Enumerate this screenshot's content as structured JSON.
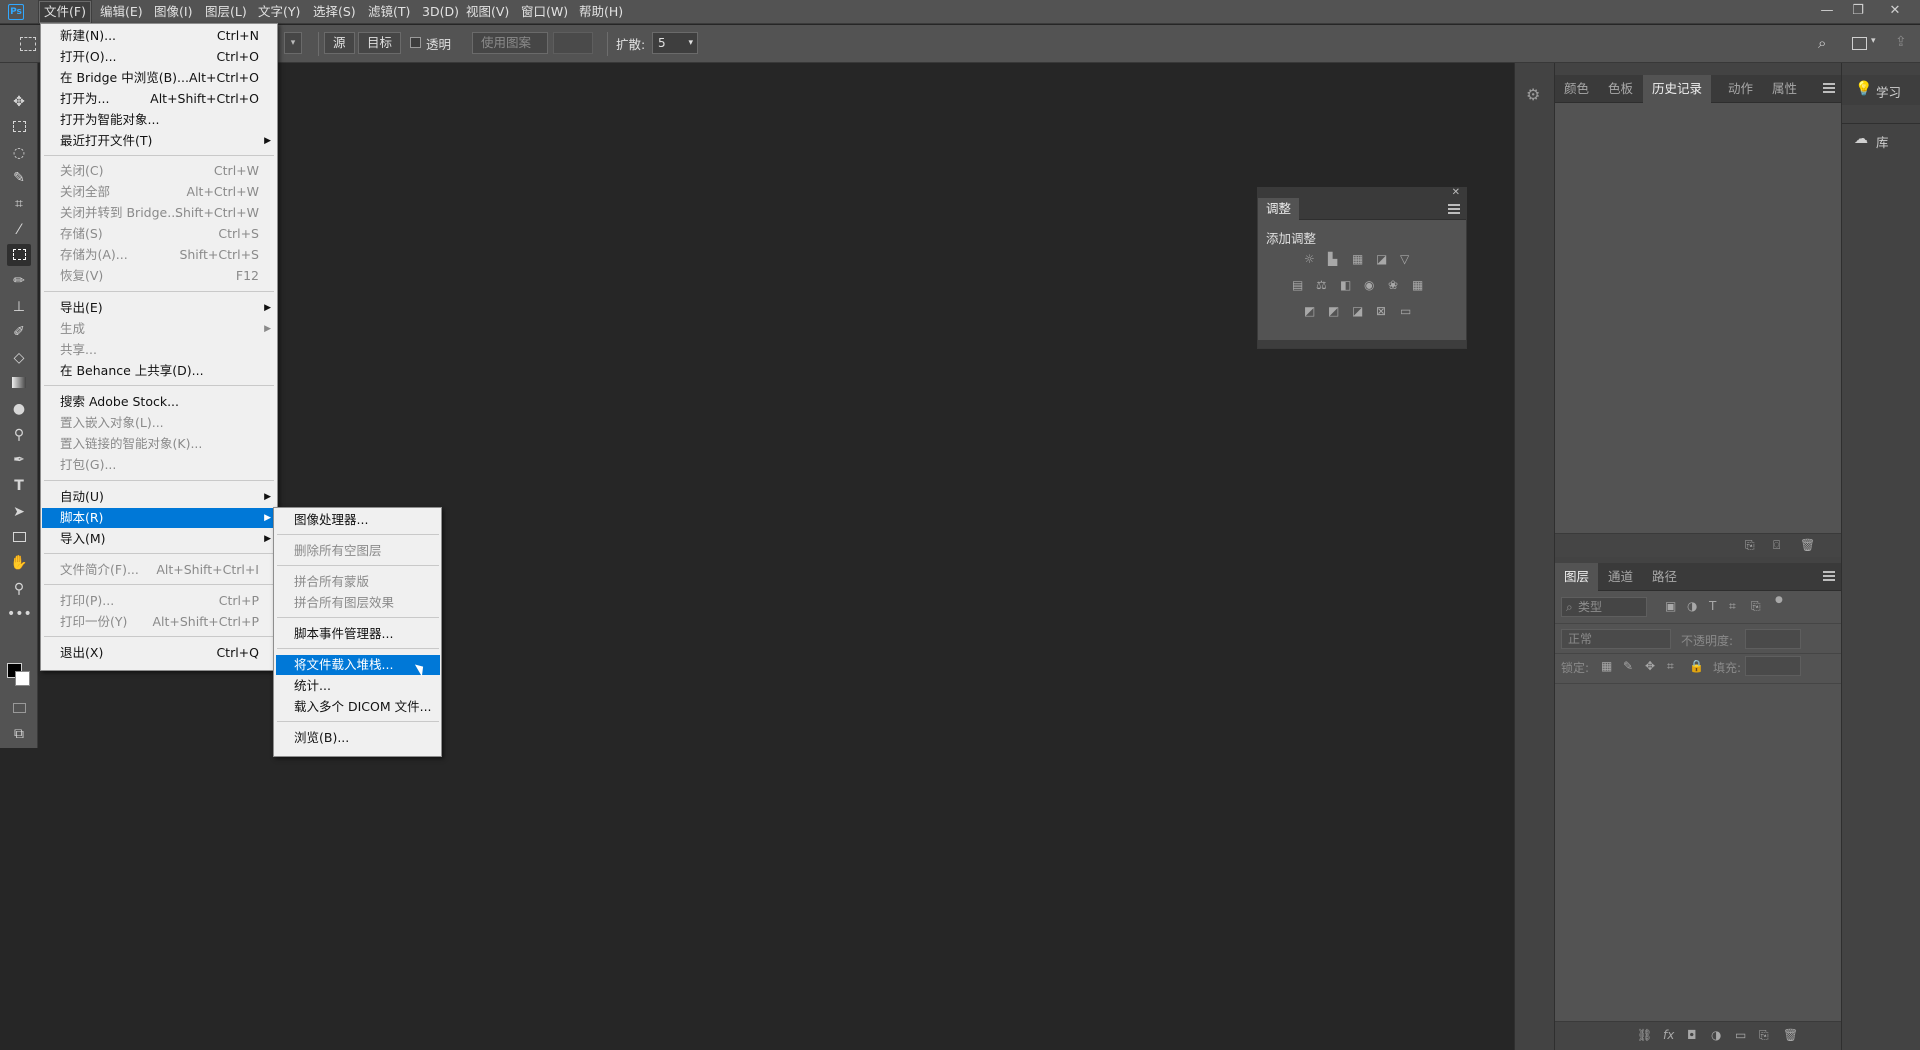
{
  "app": {
    "logo": "Ps"
  },
  "menubar": {
    "items": [
      "文件(F)",
      "编辑(E)",
      "图像(I)",
      "图层(L)",
      "文字(Y)",
      "选择(S)",
      "滤镜(T)",
      "3D(D)",
      "视图(V)",
      "窗口(W)",
      "帮助(H)"
    ]
  },
  "window_controls": {
    "minimize": "—",
    "restore": "❐",
    "close": "✕"
  },
  "options_bar": {
    "source": "源",
    "target": "目标",
    "transparent": "透明",
    "use_pattern": "使用图案",
    "diffusion_label": "扩散:",
    "diffusion_value": "5"
  },
  "file_menu": {
    "items": [
      {
        "label": "新建(N)...",
        "shortcut": "Ctrl+N",
        "disabled": false
      },
      {
        "label": "打开(O)...",
        "shortcut": "Ctrl+O",
        "disabled": false
      },
      {
        "label": "在 Bridge 中浏览(B)...",
        "shortcut": "Alt+Ctrl+O",
        "disabled": false
      },
      {
        "label": "打开为...",
        "shortcut": "Alt+Shift+Ctrl+O",
        "disabled": false
      },
      {
        "label": "打开为智能对象...",
        "shortcut": "",
        "disabled": false
      },
      {
        "label": "最近打开文件(T)",
        "shortcut": "",
        "disabled": false,
        "submenu": true
      },
      {
        "label": "关闭(C)",
        "shortcut": "Ctrl+W",
        "disabled": true
      },
      {
        "label": "关闭全部",
        "shortcut": "Alt+Ctrl+W",
        "disabled": true
      },
      {
        "label": "关闭并转到 Bridge...",
        "shortcut": "Shift+Ctrl+W",
        "disabled": true
      },
      {
        "label": "存储(S)",
        "shortcut": "Ctrl+S",
        "disabled": true
      },
      {
        "label": "存储为(A)...",
        "shortcut": "Shift+Ctrl+S",
        "disabled": true
      },
      {
        "label": "恢复(V)",
        "shortcut": "F12",
        "disabled": true
      },
      {
        "label": "导出(E)",
        "shortcut": "",
        "disabled": false,
        "submenu": true
      },
      {
        "label": "生成",
        "shortcut": "",
        "disabled": true,
        "submenu": true
      },
      {
        "label": "共享...",
        "shortcut": "",
        "disabled": true
      },
      {
        "label": "在 Behance 上共享(D)...",
        "shortcut": "",
        "disabled": false
      },
      {
        "label": "搜索 Adobe Stock...",
        "shortcut": "",
        "disabled": false
      },
      {
        "label": "置入嵌入对象(L)...",
        "shortcut": "",
        "disabled": true
      },
      {
        "label": "置入链接的智能对象(K)...",
        "shortcut": "",
        "disabled": true
      },
      {
        "label": "打包(G)...",
        "shortcut": "",
        "disabled": true
      },
      {
        "label": "自动(U)",
        "shortcut": "",
        "disabled": false,
        "submenu": true
      },
      {
        "label": "脚本(R)",
        "shortcut": "",
        "disabled": false,
        "submenu": true,
        "highlighted": true
      },
      {
        "label": "导入(M)",
        "shortcut": "",
        "disabled": false,
        "submenu": true
      },
      {
        "label": "文件简介(F)...",
        "shortcut": "Alt+Shift+Ctrl+I",
        "disabled": true
      },
      {
        "label": "打印(P)...",
        "shortcut": "Ctrl+P",
        "disabled": true
      },
      {
        "label": "打印一份(Y)",
        "shortcut": "Alt+Shift+Ctrl+P",
        "disabled": true
      },
      {
        "label": "退出(X)",
        "shortcut": "Ctrl+Q",
        "disabled": false
      }
    ]
  },
  "scripts_submenu": {
    "items": [
      {
        "label": "图像处理器...",
        "disabled": false
      },
      {
        "label": "删除所有空图层",
        "disabled": true
      },
      {
        "label": "拼合所有蒙版",
        "disabled": true
      },
      {
        "label": "拼合所有图层效果",
        "disabled": true
      },
      {
        "label": "脚本事件管理器...",
        "disabled": false
      },
      {
        "label": "将文件载入堆栈...",
        "disabled": false,
        "highlighted": true
      },
      {
        "label": "统计...",
        "disabled": false
      },
      {
        "label": "载入多个 DICOM 文件...",
        "disabled": false
      },
      {
        "label": "浏览(B)...",
        "disabled": false
      }
    ]
  },
  "adjustments_panel": {
    "tab": "调整",
    "heading": "添加调整"
  },
  "top_panel": {
    "tabs": [
      "颜色",
      "色板",
      "历史记录",
      "动作",
      "属性"
    ],
    "active": "历史记录"
  },
  "layers_panel": {
    "tabs": [
      "图层",
      "通道",
      "路径"
    ],
    "active": "图层",
    "filter_placeholder": "类型",
    "blend_mode": "正常",
    "opacity_label": "不透明度:",
    "lock_label": "锁定:",
    "fill_label": "填充:"
  },
  "right_column": {
    "learn": "学习",
    "libraries": "库"
  },
  "colors": {
    "highlight": "#0078d7",
    "accent": "#31a8ff"
  }
}
